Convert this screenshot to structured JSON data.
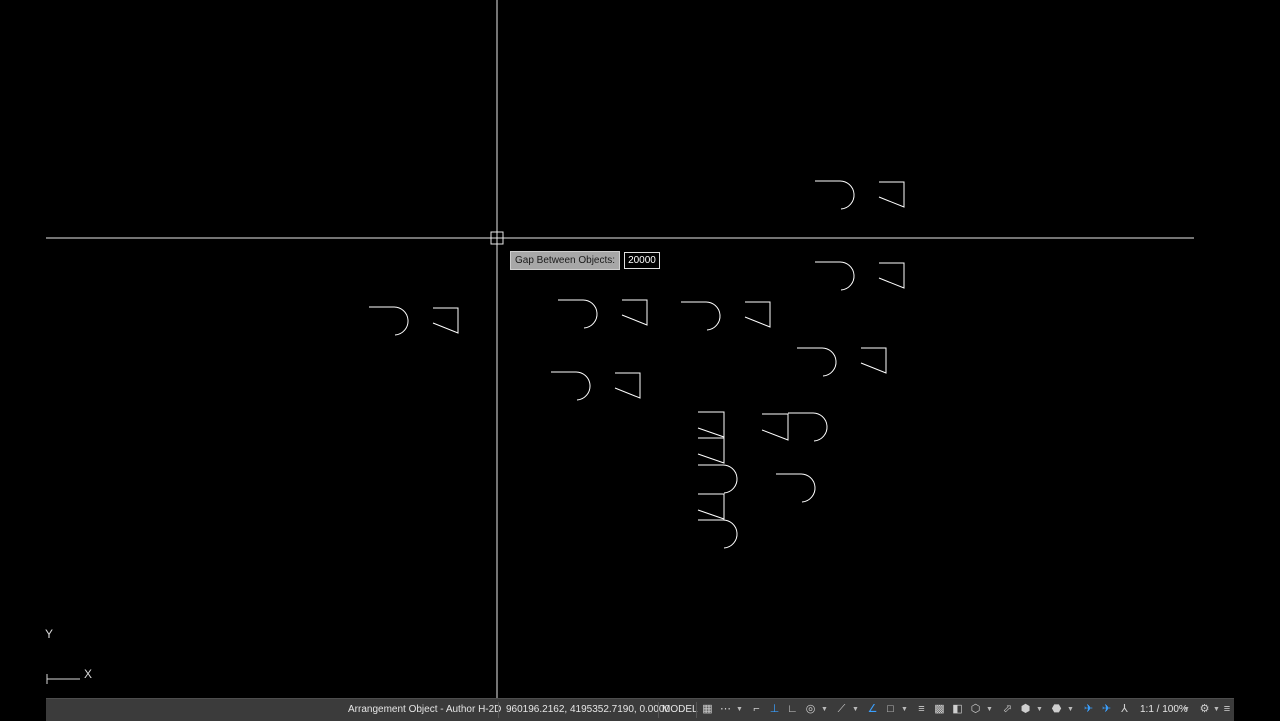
{
  "tooltip": {
    "label": "Gap Between Objects:",
    "value": "20000"
  },
  "ucs": {
    "y_label": "Y",
    "x_label": "X"
  },
  "status_bar": {
    "command_label": "Arrangement Object - Author H-2D",
    "coordinates": "960196.2162, 4195352.7190, 0.0000",
    "space": "MODEL",
    "annotation_scale": "1:1 / 100%"
  },
  "icons": [
    "grid-icon",
    "snap-icon",
    "infer-icon",
    "dynamic-ucs-icon",
    "ortho-icon",
    "polar-icon",
    "isodraft-icon",
    "osnap-track-icon",
    "osnap-icon",
    "lineweight-icon",
    "transparency-icon",
    "selection-cycling-icon",
    "3d-osnap-icon",
    "dynamic-input-icon",
    "gizmo-icon",
    "isolate-icon",
    "annotation-monitor-icon",
    "units-icon",
    "quick-props-icon",
    "lock-ui-icon",
    "workspace-icon",
    "customize-icon"
  ],
  "colors": {
    "background": "#000000",
    "geometry": "#ffffff",
    "statusbar": "#3b3b3b",
    "active_icon": "#3aa0ff"
  }
}
